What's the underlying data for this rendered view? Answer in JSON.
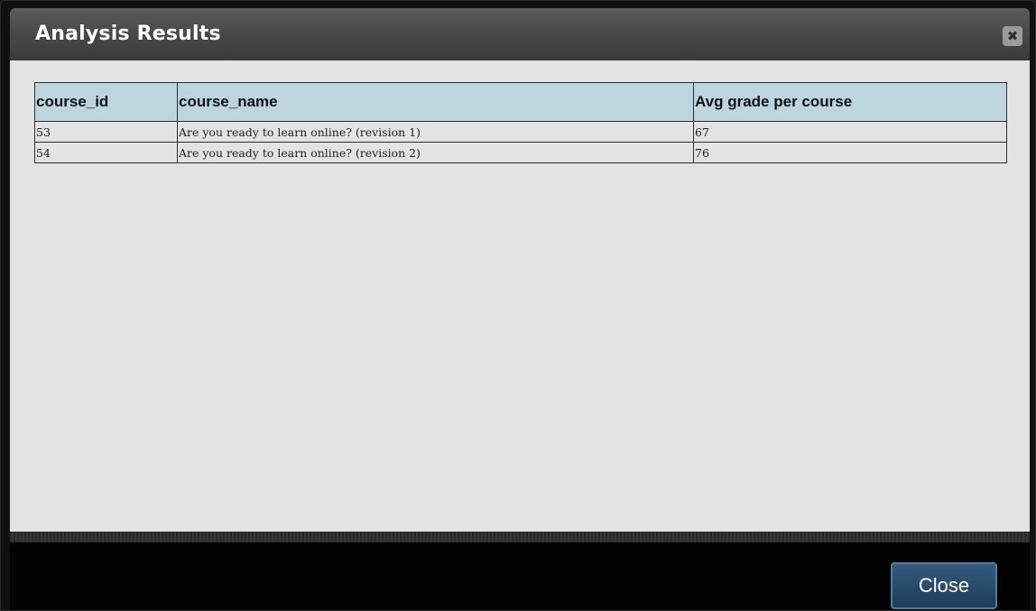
{
  "dialog": {
    "title": "Analysis Results",
    "close_icon_glyph": "✖",
    "close_button_label": "Close"
  },
  "table": {
    "headers": [
      "course_id",
      "course_name",
      "Avg grade per course"
    ],
    "rows": [
      [
        "53",
        "Are you ready to learn online? (revision 1)",
        "67"
      ],
      [
        "54",
        "Are you ready to learn online? (revision 2)",
        "76"
      ]
    ]
  },
  "colors": {
    "header_bg": "#bdd5df",
    "content_bg": "#e3e3e3",
    "button_accent": "#1d3d59"
  }
}
